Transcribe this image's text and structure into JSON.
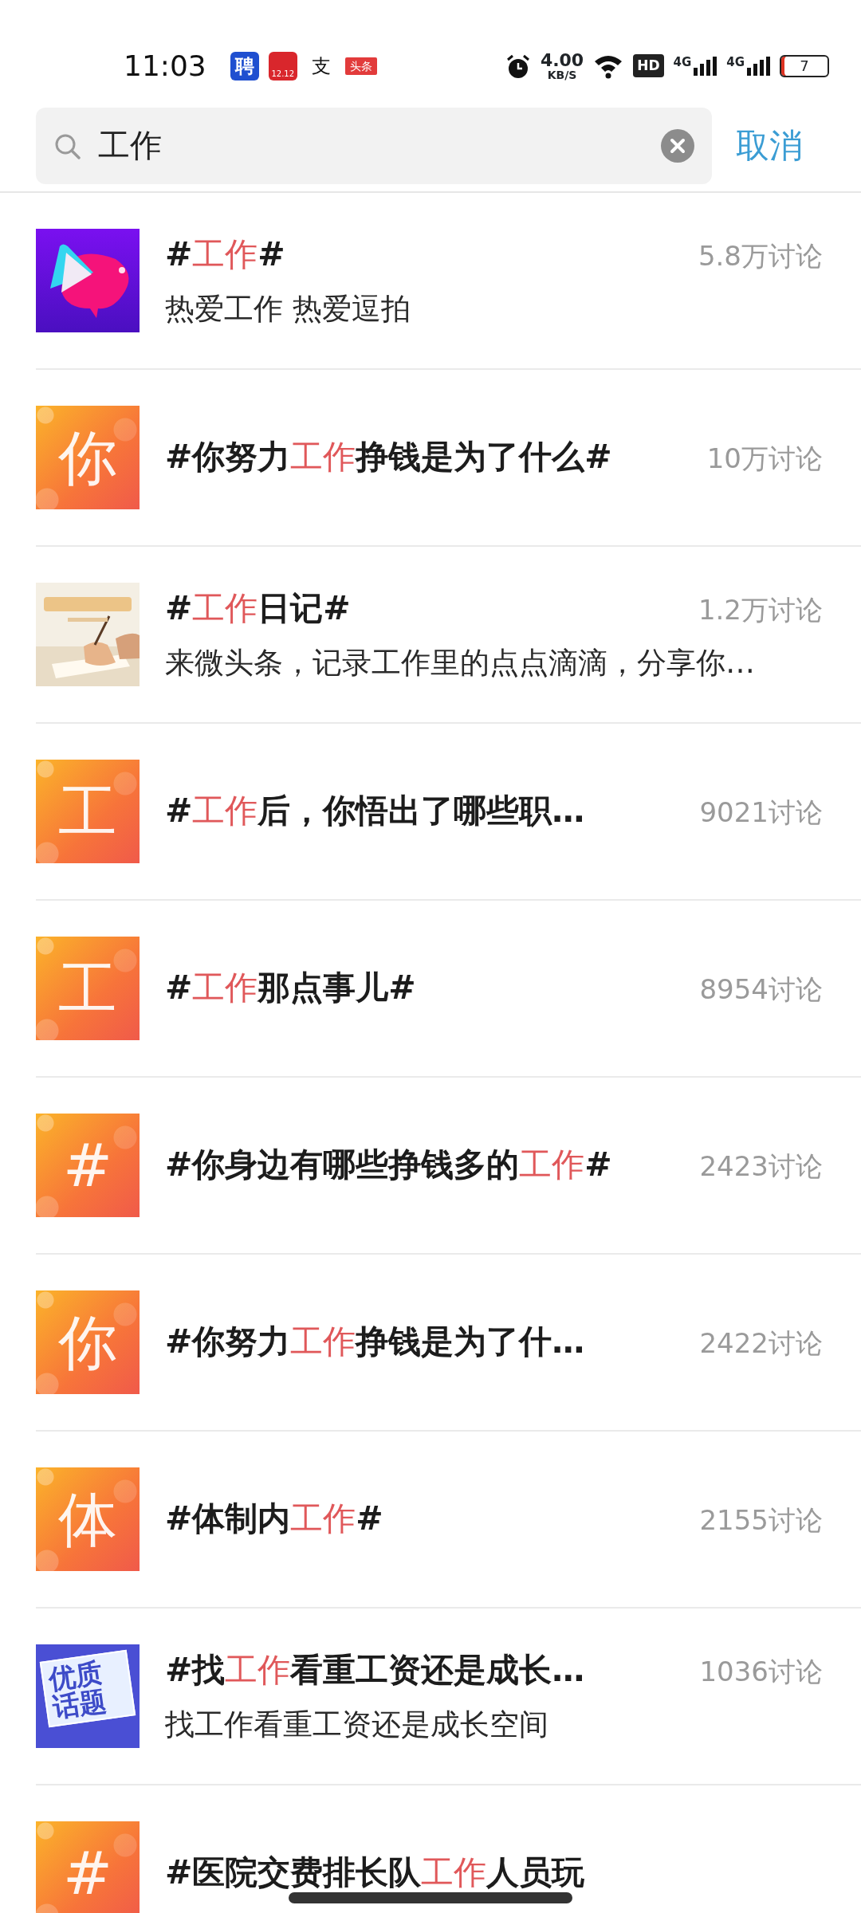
{
  "status_bar": {
    "time": "11:03",
    "notifications": [
      {
        "kind": "blue",
        "label": "聘"
      },
      {
        "kind": "heart",
        "label": "12.12"
      },
      {
        "kind": "plain",
        "label": "支"
      },
      {
        "kind": "red",
        "label": "头条"
      }
    ],
    "speed": "4.00",
    "speed_unit": "KB/S",
    "hd": "HD",
    "signal_labels": [
      "4G",
      "4G"
    ],
    "battery": "7"
  },
  "search": {
    "value": "工作",
    "cancel": "取消"
  },
  "results": [
    {
      "thumb": {
        "kind": "app-logo"
      },
      "title": [
        {
          "text": "#",
          "hit": false
        },
        {
          "text": "工作",
          "hit": true
        },
        {
          "text": "#",
          "hit": false
        }
      ],
      "subtitle": "热爱工作 热爱逗拍",
      "count": "5.8万讨论"
    },
    {
      "thumb": {
        "kind": "letter",
        "char": "你"
      },
      "title": [
        {
          "text": "#你努力",
          "hit": false
        },
        {
          "text": "工作",
          "hit": true
        },
        {
          "text": "挣钱是为了什么#",
          "hit": false
        }
      ],
      "count": "10万讨论"
    },
    {
      "thumb": {
        "kind": "picture"
      },
      "title": [
        {
          "text": "#",
          "hit": false
        },
        {
          "text": "工作",
          "hit": true
        },
        {
          "text": "日记#",
          "hit": false
        }
      ],
      "subtitle": "来微头条，记录工作里的点点滴滴，分享你…",
      "count": "1.2万讨论"
    },
    {
      "thumb": {
        "kind": "letter",
        "char": "工"
      },
      "title": [
        {
          "text": "#",
          "hit": false
        },
        {
          "text": "工作",
          "hit": true
        },
        {
          "text": "后，你悟出了哪些职…",
          "hit": false
        }
      ],
      "count": "9021讨论"
    },
    {
      "thumb": {
        "kind": "letter",
        "char": "工"
      },
      "title": [
        {
          "text": "#",
          "hit": false
        },
        {
          "text": "工作",
          "hit": true
        },
        {
          "text": "那点事儿#",
          "hit": false
        }
      ],
      "count": "8954讨论"
    },
    {
      "thumb": {
        "kind": "letter",
        "char": "#"
      },
      "title": [
        {
          "text": "#你身边有哪些挣钱多的",
          "hit": false
        },
        {
          "text": "工作",
          "hit": true
        },
        {
          "text": "#",
          "hit": false
        }
      ],
      "count": "2423讨论"
    },
    {
      "thumb": {
        "kind": "letter",
        "char": "你"
      },
      "title": [
        {
          "text": "#你努力",
          "hit": false
        },
        {
          "text": "工作",
          "hit": true
        },
        {
          "text": "挣钱是为了什…",
          "hit": false
        }
      ],
      "count": "2422讨论"
    },
    {
      "thumb": {
        "kind": "letter",
        "char": "体"
      },
      "title": [
        {
          "text": "#体制内",
          "hit": false
        },
        {
          "text": "工作",
          "hit": true
        },
        {
          "text": "#",
          "hit": false
        }
      ],
      "count": "2155讨论"
    },
    {
      "thumb": {
        "kind": "badge",
        "lines": [
          "优质",
          "话题"
        ]
      },
      "title": [
        {
          "text": "#找",
          "hit": false
        },
        {
          "text": "工作",
          "hit": true
        },
        {
          "text": "看重工资还是成长…",
          "hit": false
        }
      ],
      "subtitle": "找工作看重工资还是成长空间",
      "count": "1036讨论"
    },
    {
      "thumb": {
        "kind": "letter",
        "char": "#"
      },
      "title": [
        {
          "text": "#医院交费排长队",
          "hit": false
        },
        {
          "text": "工作",
          "hit": true
        },
        {
          "text": "人员玩",
          "hit": false
        }
      ]
    }
  ]
}
